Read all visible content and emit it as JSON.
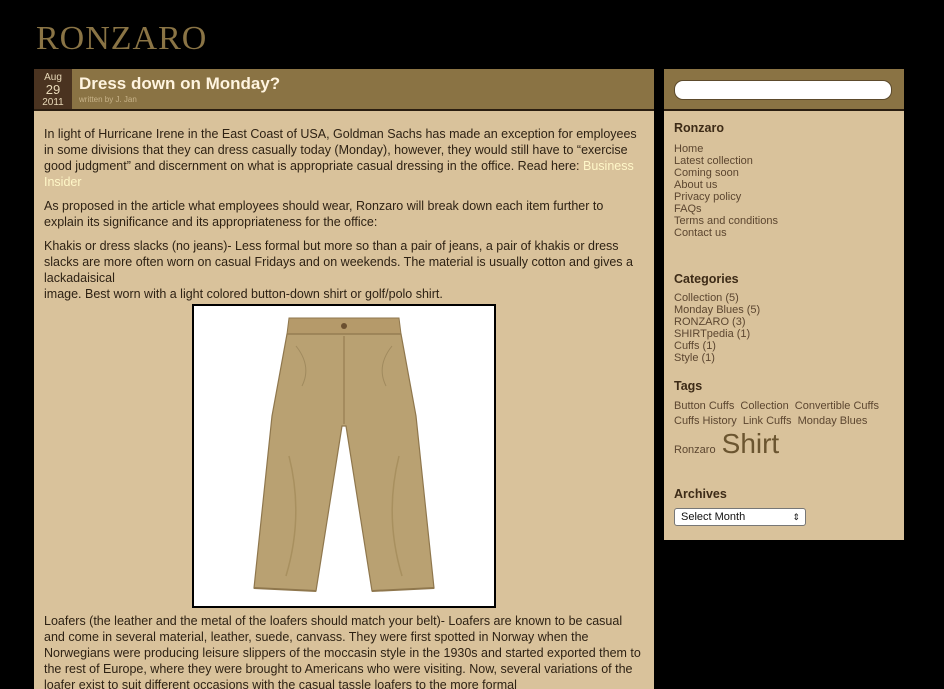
{
  "site": {
    "logo": "RONZARO"
  },
  "post": {
    "month": "Aug",
    "day": "29",
    "year": "2011",
    "title": "Dress down on Monday?",
    "byline": "written by J. Jan",
    "p1": "In light of Hurricane Irene in the East Coast of USA, Goldman Sachs has made an exception for employees in some divisions that they can dress casually today (Monday), however, they would still have to “exercise good judgment” and discernment on what is appropriate casual dressing in the office. Read here:",
    "p1_link": "Business Insider",
    "p2": "As proposed in the article what employees should wear, Ronzaro will break down each item further to explain its significance and its appropriateness for the office:",
    "p3a": "Khakis or dress slacks (no jeans)- Less formal but more so than a pair of jeans, a pair of khakis or dress slacks are more often worn on casual Fridays and on weekends. The material is usually cotton and gives a lackadaisical",
    "p3b": "image. Best worn with a light colored button-down shirt or golf/polo shirt.",
    "p4": "Loafers (the leather and the metal of the loafers should match your belt)- Loafers are known to be casual and come in several material, leather, suede, canvass. They were first spotted in Norway when the Norwegians were producing leisure slippers of the moccasin style in the 1930s and started exported them to the rest of Europe, where they were brought to Americans who were visiting. Now, several variations of the loafer exist to suit different occasions with the casual tassle loafers to the more formal"
  },
  "sidebar": {
    "search_placeholder": "",
    "ronzaro_title": "Ronzaro",
    "ronzaro_links": [
      "Home",
      "Latest collection",
      "Coming soon",
      "About us",
      "Privacy policy",
      "FAQs",
      "Terms and conditions",
      "Contact us"
    ],
    "categories_title": "Categories",
    "categories": [
      "Collection (5)",
      "Monday Blues (5)",
      "RONZARO (3)",
      "SHIRTpedia (1)",
      "Cuffs (1)",
      "Style (1)"
    ],
    "tags_title": "Tags",
    "tags": [
      "Button Cuffs",
      "Collection",
      "Convertible Cuffs",
      "Cuffs History",
      "Link Cuffs",
      "Monday Blues",
      "Ronzaro",
      "Shirt"
    ],
    "archives_title": "Archives",
    "archives_select": "Select Month"
  }
}
